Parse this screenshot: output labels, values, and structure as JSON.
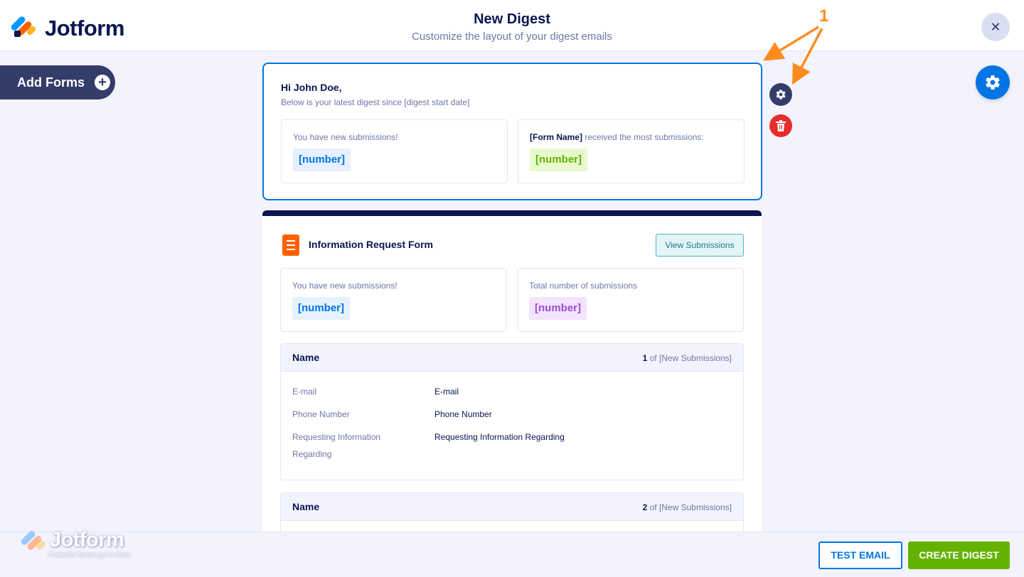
{
  "header": {
    "brand": "Jotform",
    "title": "New Digest",
    "subtitle": "Customize the layout of your digest emails",
    "close_glyph": "✕"
  },
  "sidebar": {
    "add_forms_label": "Add Forms",
    "add_icon_glyph": "+"
  },
  "greeting": {
    "title": "Hi John Doe,",
    "subtitle": "Below is your latest digest since [digest start date]",
    "left_box": {
      "label": "You have new submissions!",
      "value": "[number]"
    },
    "right_box": {
      "label_bold": "[Form Name]",
      "label_rest": " received the most submissions:",
      "value": "[number]"
    }
  },
  "form_card": {
    "form_name": "Information Request Form",
    "view_button": "View Submissions",
    "left_box": {
      "label": "You have new submissions!",
      "value": "[number]"
    },
    "right_box": {
      "label": "Total number of submissions",
      "value": "[number]"
    },
    "submissions": [
      {
        "name": "Name",
        "index": "1",
        "of_text": " of [New Submissions]",
        "fields": [
          {
            "label": "E-mail",
            "value": "E-mail"
          },
          {
            "label": "Phone Number",
            "value": "Phone Number"
          },
          {
            "label": "Requesting Information Regarding",
            "value": "Requesting Information Regarding"
          }
        ]
      },
      {
        "name": "Name",
        "index": "2",
        "of_text": " of [New Submissions]"
      }
    ]
  },
  "footer": {
    "test_email": "TEST EMAIL",
    "create_digest": "CREATE DIGEST",
    "watermark_brand": "Jotform",
    "watermark_tagline": "Powerful forms get it done"
  },
  "annotation": {
    "callout_number": "1",
    "color": "#ff8b1f"
  },
  "colors": {
    "accent": "#0075e3",
    "navy": "#0a1551",
    "success": "#64b200",
    "danger": "#e62c2c",
    "form_icon": "#ff6100"
  },
  "icons": {
    "settings": "gear-icon",
    "delete": "trash-icon",
    "close": "close-icon",
    "add": "plus-circle-icon",
    "form": "form-document-icon"
  }
}
